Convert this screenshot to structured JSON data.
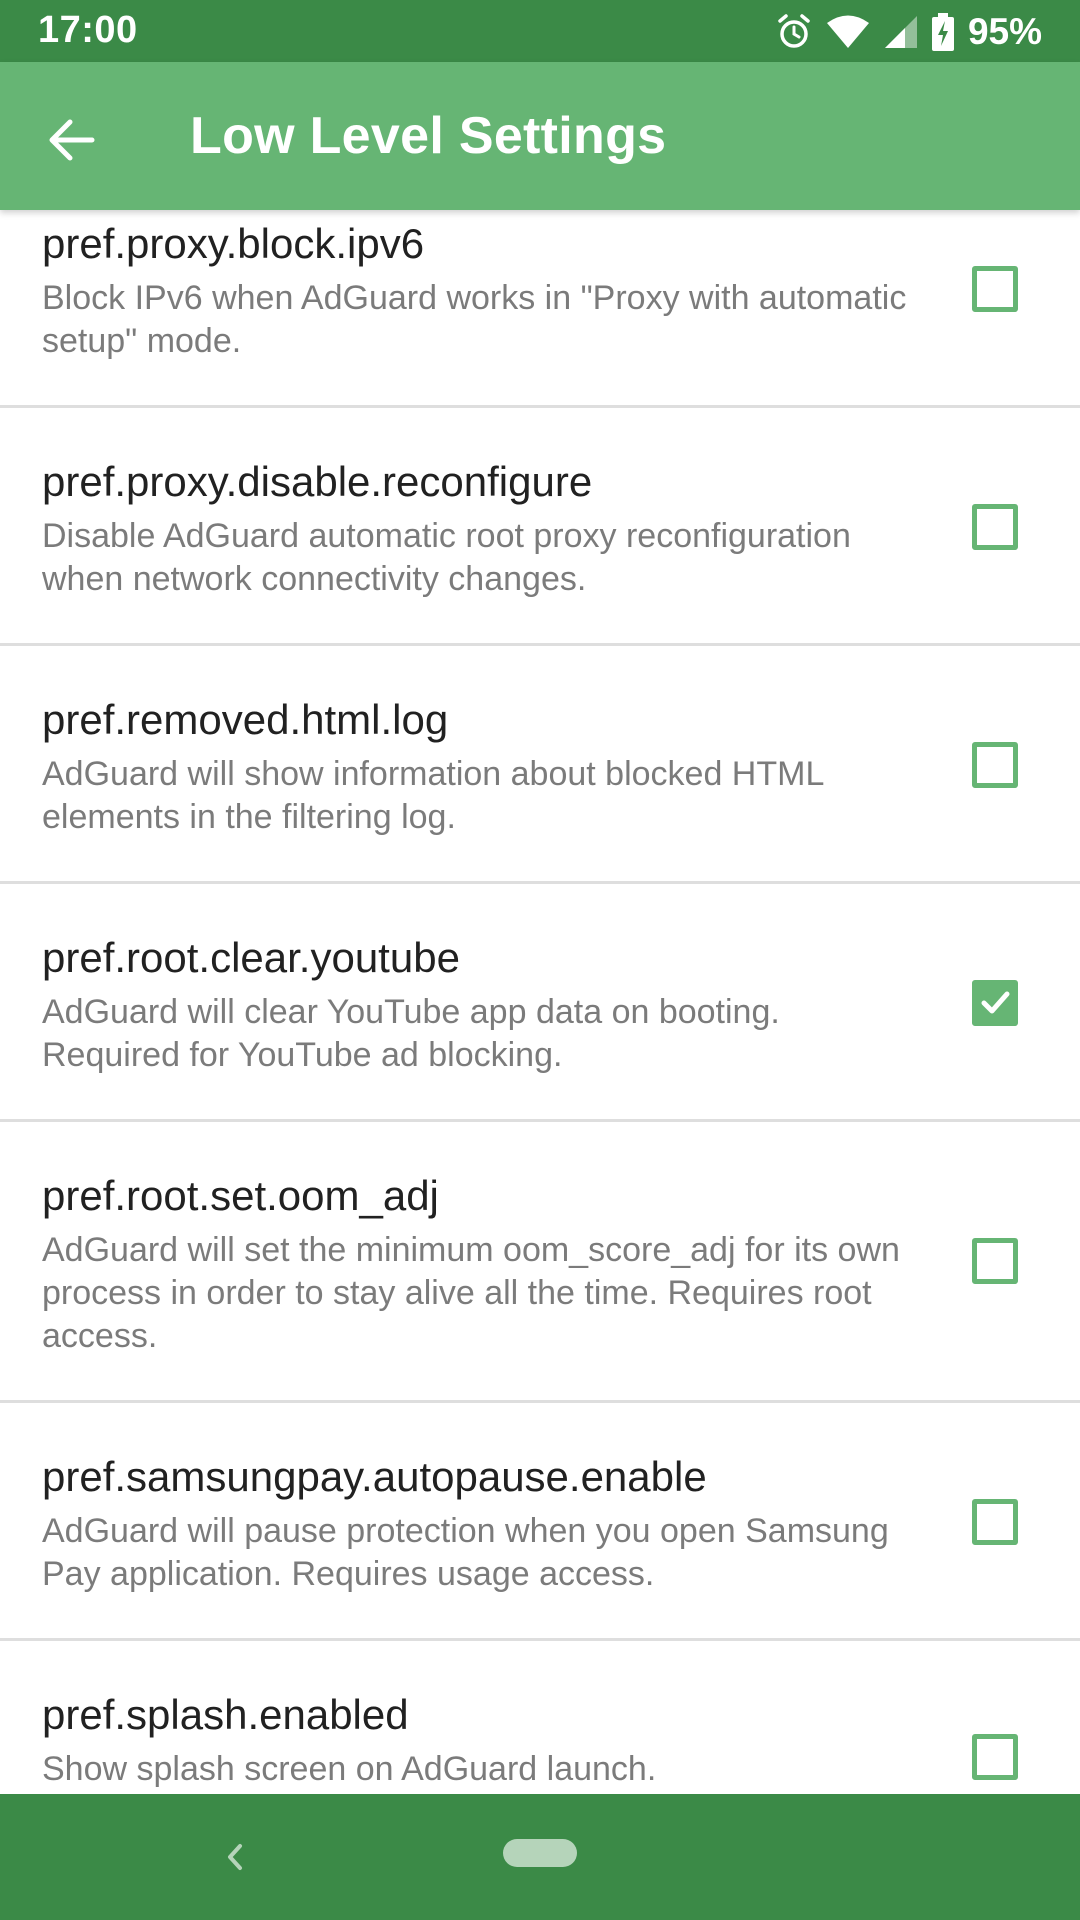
{
  "status_bar": {
    "time": "17:00",
    "battery_percent": "95%",
    "icons": [
      "alarm-icon",
      "wifi-icon",
      "cellular-signal-icon",
      "battery-charging-icon"
    ]
  },
  "app_bar": {
    "title": "Low Level Settings",
    "back_icon": "arrow-back-icon"
  },
  "colors": {
    "status_bar": "#3b8a47",
    "app_bar": "#66b574",
    "accent": "#66b574",
    "nav_bar": "#3b8a47"
  },
  "settings": [
    {
      "key": "pref.proxy.block.ipv6",
      "description": "Block IPv6 when AdGuard works in \"Proxy with automatic setup\" mode.",
      "checked": false
    },
    {
      "key": "pref.proxy.disable.reconfigure",
      "description": "Disable AdGuard automatic root proxy reconfiguration when network connectivity changes.",
      "checked": false
    },
    {
      "key": "pref.removed.html.log",
      "description": "AdGuard will show information about blocked HTML elements in the filtering log.",
      "checked": false
    },
    {
      "key": "pref.root.clear.youtube",
      "description": "AdGuard will clear YouTube app data on booting. Required for YouTube ad blocking.",
      "checked": true
    },
    {
      "key": "pref.root.set.oom_adj",
      "description": "AdGuard will set the minimum oom_score_adj for its own process in order to stay alive all the time. Requires root access.",
      "checked": false
    },
    {
      "key": "pref.samsungpay.autopause.enable",
      "description": "AdGuard will pause protection when you open Samsung Pay application. Requires usage access.",
      "checked": false
    },
    {
      "key": "pref.splash.enabled",
      "description": "Show splash screen on AdGuard launch.",
      "checked": false
    }
  ],
  "nav_bar": {
    "icons": [
      "nav-back-icon",
      "home-pill-icon"
    ]
  }
}
